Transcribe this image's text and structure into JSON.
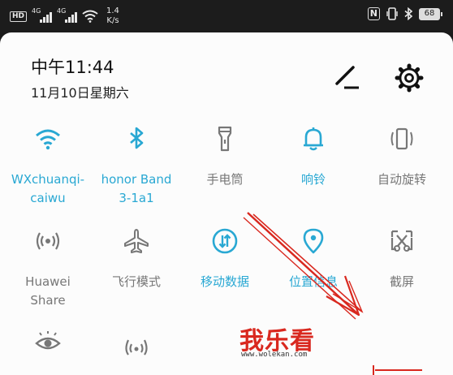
{
  "status_bar": {
    "left_badge": "HD",
    "sim1_gen": "4G",
    "sim2_gen": "4G",
    "net_speed_value": "1.4",
    "net_speed_unit": "K/s",
    "battery": "68"
  },
  "header": {
    "time": "中午11:44",
    "date": "11月10日星期六"
  },
  "tiles": [
    {
      "id": "wifi",
      "label": "WXchuanqi-\ncaiwu",
      "icon": "wifi-icon",
      "active": true
    },
    {
      "id": "bluetooth",
      "label": "honor Band\n3-1a1",
      "icon": "bluetooth-icon",
      "active": true
    },
    {
      "id": "flashlight",
      "label": "手电筒",
      "icon": "flashlight-icon",
      "active": false
    },
    {
      "id": "ring",
      "label": "响铃",
      "icon": "bell-icon",
      "active": true
    },
    {
      "id": "autorotate",
      "label": "自动旋转",
      "icon": "rotate-icon",
      "active": false
    },
    {
      "id": "huawei-share",
      "label": "Huawei\nShare",
      "icon": "share-icon",
      "active": false
    },
    {
      "id": "airplane",
      "label": "飞行模式",
      "icon": "airplane-icon",
      "active": false
    },
    {
      "id": "mobile-data",
      "label": "移动数据",
      "icon": "mobile-data-icon",
      "active": true
    },
    {
      "id": "location",
      "label": "位置信息",
      "icon": "location-icon",
      "active": true
    },
    {
      "id": "screenshot",
      "label": "截屏",
      "icon": "screenshot-icon",
      "active": false
    },
    {
      "id": "eye-comfort",
      "label": "",
      "icon": "eye-icon",
      "active": false
    },
    {
      "id": "nfc",
      "label": "",
      "icon": "nfc-icon",
      "active": false
    }
  ],
  "watermark": {
    "text": "我乐看",
    "url": "www.wolekan.com"
  },
  "colors": {
    "accent": "#29a8d3",
    "inactive": "#777777",
    "annotation": "#d9281f"
  }
}
